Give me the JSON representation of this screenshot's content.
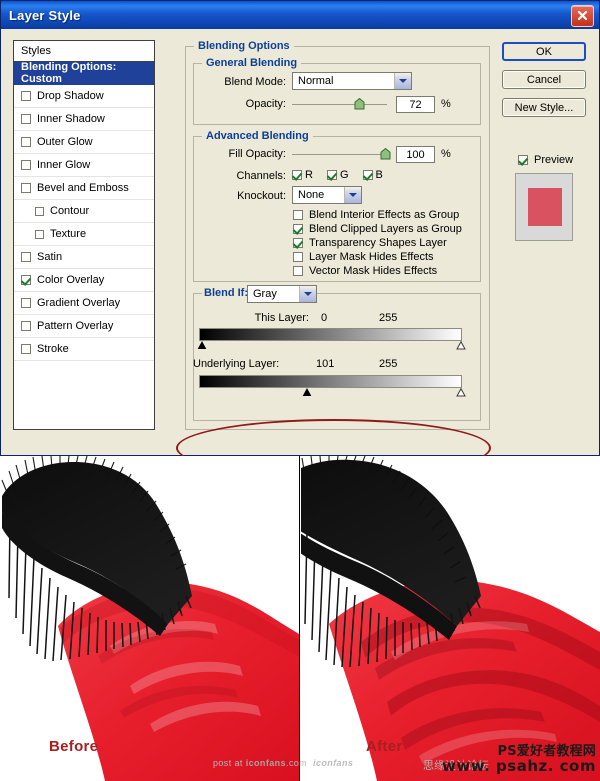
{
  "window": {
    "title": "Layer Style",
    "close_icon": "close-icon"
  },
  "styles_panel": {
    "header": "Styles",
    "items": [
      {
        "label": "Blending Options: Custom",
        "checkbox": false,
        "selected": true,
        "indent": false
      },
      {
        "label": "Drop Shadow",
        "checkbox": true,
        "checked": false,
        "indent": false
      },
      {
        "label": "Inner Shadow",
        "checkbox": true,
        "checked": false,
        "indent": false
      },
      {
        "label": "Outer Glow",
        "checkbox": true,
        "checked": false,
        "indent": false
      },
      {
        "label": "Inner Glow",
        "checkbox": true,
        "checked": false,
        "indent": false
      },
      {
        "label": "Bevel and Emboss",
        "checkbox": true,
        "checked": false,
        "indent": false
      },
      {
        "label": "Contour",
        "checkbox": true,
        "checked": false,
        "indent": true
      },
      {
        "label": "Texture",
        "checkbox": true,
        "checked": false,
        "indent": true
      },
      {
        "label": "Satin",
        "checkbox": true,
        "checked": false,
        "indent": false
      },
      {
        "label": "Color Overlay",
        "checkbox": true,
        "checked": true,
        "indent": false
      },
      {
        "label": "Gradient Overlay",
        "checkbox": true,
        "checked": false,
        "indent": false
      },
      {
        "label": "Pattern Overlay",
        "checkbox": true,
        "checked": false,
        "indent": false
      },
      {
        "label": "Stroke",
        "checkbox": true,
        "checked": false,
        "indent": false
      }
    ]
  },
  "blending_options": {
    "legend": "Blending Options",
    "general": {
      "legend": "General Blending",
      "blend_mode_label": "Blend Mode:",
      "blend_mode_value": "Normal",
      "opacity_label": "Opacity:",
      "opacity_value": "72",
      "opacity_unit": "%",
      "opacity_percent": 72
    },
    "advanced": {
      "legend": "Advanced Blending",
      "fill_opacity_label": "Fill Opacity:",
      "fill_opacity_value": "100",
      "fill_opacity_unit": "%",
      "fill_opacity_percent": 100,
      "channels_label": "Channels:",
      "channels": [
        {
          "label": "R",
          "checked": true
        },
        {
          "label": "G",
          "checked": true
        },
        {
          "label": "B",
          "checked": true
        }
      ],
      "knockout_label": "Knockout:",
      "knockout_value": "None",
      "options": [
        {
          "label": "Blend Interior Effects as Group",
          "checked": false
        },
        {
          "label": "Blend Clipped Layers as Group",
          "checked": true
        },
        {
          "label": "Transparency Shapes Layer",
          "checked": true
        },
        {
          "label": "Layer Mask Hides Effects",
          "checked": false
        },
        {
          "label": "Vector Mask Hides Effects",
          "checked": false
        }
      ]
    },
    "blend_if": {
      "legend_label": "Blend If:",
      "channel_value": "Gray",
      "this_layer": {
        "label": "This Layer:",
        "black_value": "0",
        "white_value": "255",
        "black_pos_percent": 0,
        "white_pos_percent": 100
      },
      "underlying_layer": {
        "label": "Underlying Layer:",
        "black_value": "101",
        "white_value": "255",
        "black_pos_percent": 40,
        "white_pos_percent": 100
      }
    }
  },
  "buttons": {
    "ok": "OK",
    "cancel": "Cancel",
    "new_style": "New Style...",
    "preview_label": "Preview",
    "preview_checked": true,
    "preview_color": "#d9525f"
  },
  "annotation": {
    "shape": "ellipse",
    "color": "#8f1a1a",
    "targets": "Underlying Layer slider"
  },
  "comparison": {
    "before_caption": "Before",
    "after_caption": "After",
    "caption_color": "#a81f1f",
    "paint_red": "#e8202e",
    "bristle_black": "#141414"
  },
  "watermarks": {
    "iconfans_prefix": "post at ",
    "iconfans_brand": "iconfans",
    "iconfans_suffix": ".com",
    "iconfans_logo": "iconfans",
    "cn_forum": "思缘设计论坛",
    "ps_line1": "PS爱好者教程网",
    "ps_line2": "www. psahz. com"
  }
}
